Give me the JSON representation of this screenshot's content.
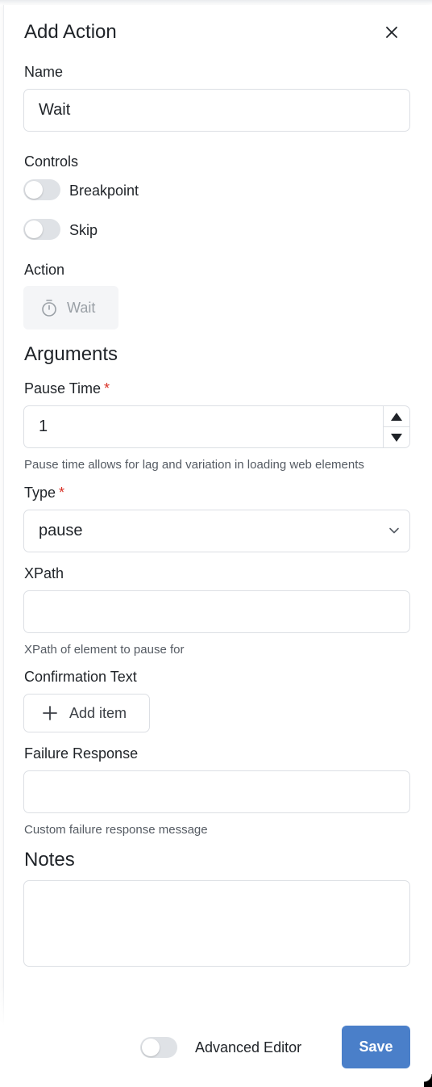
{
  "dialog": {
    "title": "Add Action",
    "close_icon": "close-icon"
  },
  "name_field": {
    "label": "Name",
    "value": "Wait"
  },
  "controls": {
    "label": "Controls",
    "breakpoint": {
      "label": "Breakpoint",
      "on": false
    },
    "skip": {
      "label": "Skip",
      "on": false
    }
  },
  "action": {
    "label": "Action",
    "chip_label": "Wait",
    "chip_icon": "stopwatch-icon"
  },
  "arguments": {
    "heading": "Arguments",
    "pause_time": {
      "label": "Pause Time",
      "required_mark": "*",
      "value": "1",
      "help": "Pause time allows for lag and variation in loading web elements"
    },
    "type": {
      "label": "Type",
      "required_mark": "*",
      "value": "pause"
    },
    "xpath": {
      "label": "XPath",
      "value": "",
      "help": "XPath of element to pause for"
    },
    "confirmation_text": {
      "label": "Confirmation Text",
      "add_label": "Add item"
    },
    "failure_response": {
      "label": "Failure Response",
      "value": "",
      "help": "Custom failure response message"
    }
  },
  "notes": {
    "heading": "Notes",
    "value": ""
  },
  "footer": {
    "advanced_editor": {
      "label": "Advanced Editor",
      "on": false
    },
    "save_label": "Save"
  },
  "colors": {
    "primary": "#4a7fc9",
    "required": "#d93025",
    "toggle_off": "#dfe2e6",
    "border": "#dcdfe4"
  }
}
